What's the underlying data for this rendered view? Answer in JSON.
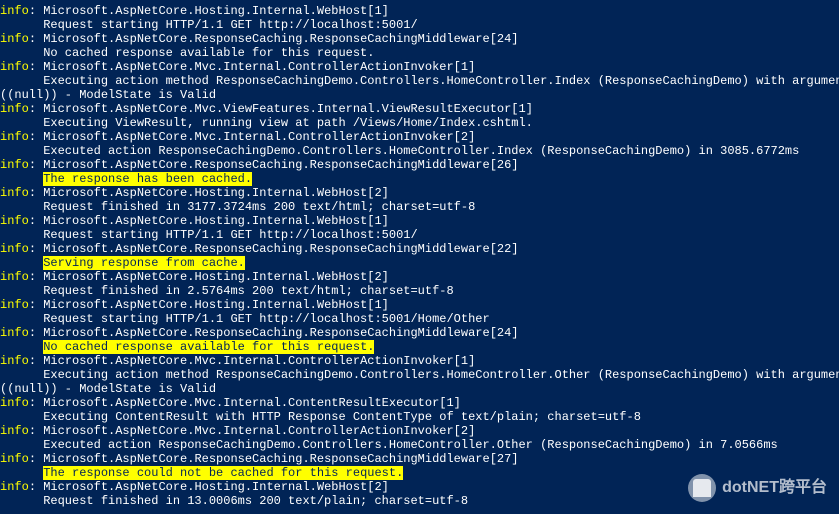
{
  "lines": [
    {
      "level": "info",
      "category": "Microsoft.AspNetCore.Hosting.Internal.WebHost[1]",
      "message": "Request starting HTTP/1.1 GET http://localhost:5001/"
    },
    {
      "level": "info",
      "category": "Microsoft.AspNetCore.ResponseCaching.ResponseCachingMiddleware[24]",
      "message": "No cached response available for this request."
    },
    {
      "level": "info",
      "category": "Microsoft.AspNetCore.Mvc.Internal.ControllerActionInvoker[1]",
      "message": "Executing action method ResponseCachingDemo.Controllers.HomeController.Index (ResponseCachingDemo) with arguments ((null)) - ModelState is Valid",
      "wrap": true
    },
    {
      "level": "info",
      "category": "Microsoft.AspNetCore.Mvc.ViewFeatures.Internal.ViewResultExecutor[1]",
      "message": "Executing ViewResult, running view at path /Views/Home/Index.cshtml."
    },
    {
      "level": "info",
      "category": "Microsoft.AspNetCore.Mvc.Internal.ControllerActionInvoker[2]",
      "message": "Executed action ResponseCachingDemo.Controllers.HomeController.Index (ResponseCachingDemo) in 3085.6772ms"
    },
    {
      "level": "info",
      "category": "Microsoft.AspNetCore.ResponseCaching.ResponseCachingMiddleware[26]",
      "message": "The response has been cached.",
      "highlight": true
    },
    {
      "level": "info",
      "category": "Microsoft.AspNetCore.Hosting.Internal.WebHost[2]",
      "message": "Request finished in 3177.3724ms 200 text/html; charset=utf-8"
    },
    {
      "level": "info",
      "category": "Microsoft.AspNetCore.Hosting.Internal.WebHost[1]",
      "message": "Request starting HTTP/1.1 GET http://localhost:5001/"
    },
    {
      "level": "info",
      "category": "Microsoft.AspNetCore.ResponseCaching.ResponseCachingMiddleware[22]",
      "message": "Serving response from cache.",
      "highlight": true
    },
    {
      "level": "info",
      "category": "Microsoft.AspNetCore.Hosting.Internal.WebHost[2]",
      "message": "Request finished in 2.5764ms 200 text/html; charset=utf-8"
    },
    {
      "level": "info",
      "category": "Microsoft.AspNetCore.Hosting.Internal.WebHost[1]",
      "message": "Request starting HTTP/1.1 GET http://localhost:5001/Home/Other"
    },
    {
      "level": "info",
      "category": "Microsoft.AspNetCore.ResponseCaching.ResponseCachingMiddleware[24]",
      "message": "No cached response available for this request.",
      "highlight": true
    },
    {
      "level": "info",
      "category": "Microsoft.AspNetCore.Mvc.Internal.ControllerActionInvoker[1]",
      "message": "Executing action method ResponseCachingDemo.Controllers.HomeController.Other (ResponseCachingDemo) with arguments ((null)) - ModelState is Valid",
      "wrap": true
    },
    {
      "level": "info",
      "category": "Microsoft.AspNetCore.Mvc.Internal.ContentResultExecutor[1]",
      "message": "Executing ContentResult with HTTP Response ContentType of text/plain; charset=utf-8"
    },
    {
      "level": "info",
      "category": "Microsoft.AspNetCore.Mvc.Internal.ControllerActionInvoker[2]",
      "message": "Executed action ResponseCachingDemo.Controllers.HomeController.Other (ResponseCachingDemo) in 7.0566ms"
    },
    {
      "level": "info",
      "category": "Microsoft.AspNetCore.ResponseCaching.ResponseCachingMiddleware[27]",
      "message": "The response could not be cached for this request.",
      "highlight": true
    },
    {
      "level": "info",
      "category": "Microsoft.AspNetCore.Hosting.Internal.WebHost[2]",
      "message": "Request finished in 13.0006ms 200 text/plain; charset=utf-8"
    }
  ],
  "watermark": "dotNET跨平台"
}
